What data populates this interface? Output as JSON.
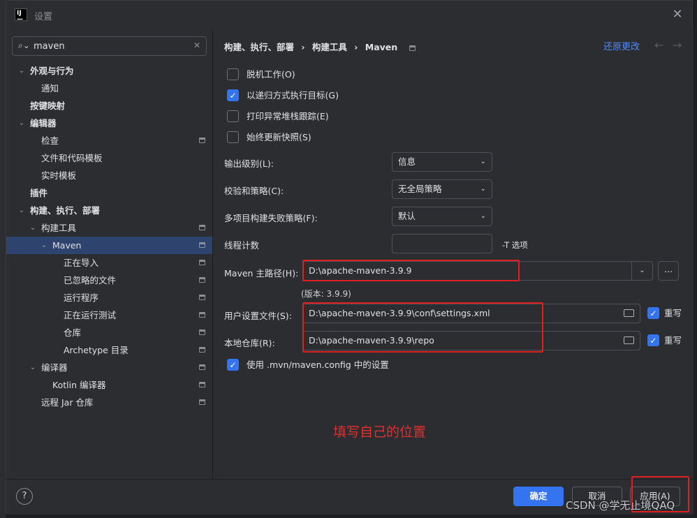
{
  "window": {
    "title": "设置"
  },
  "search": {
    "value": "maven"
  },
  "tree": {
    "appearance": "外观与行为",
    "notifications": "通知",
    "keymap": "按键映射",
    "editor": "编辑器",
    "inspections": "检查",
    "file_templates": "文件和代码模板",
    "live_templates": "实时模板",
    "plugins": "插件",
    "build": "构建、执行、部署",
    "build_tools": "构建工具",
    "maven": "Maven",
    "importing": "正在导入",
    "ignored_files": "已忽略的文件",
    "runner": "运行程序",
    "running_tests": "正在运行测试",
    "repositories": "仓库",
    "archetype": "Archetype 目录",
    "compiler": "编译器",
    "kotlin_compiler": "Kotlin 编译器",
    "remote_jar": "远程 Jar 仓库"
  },
  "breadcrumb": {
    "a": "构建、执行、部署",
    "sep": "›",
    "b": "构建工具",
    "c": "Maven"
  },
  "reset_label": "还原更改",
  "options": {
    "offline": "脱机工作(O)",
    "recursive": "以递归方式执行目标(G)",
    "print_stack": "打印异常堆栈跟踪(E)",
    "always_update": "始终更新快照(S)",
    "use_mvn_config": "使用 .mvn/maven.config 中的设置"
  },
  "form": {
    "output_level_label": "输出级别(L):",
    "output_level_value": "信息",
    "checksum_label": "校验和策略(C):",
    "checksum_value": "无全局策略",
    "fail_policy_label": "多项目构建失败策略(F):",
    "fail_policy_value": "默认",
    "threads_label": "线程计数",
    "threads_value": "",
    "threads_suffix": "-T 选项",
    "maven_home_label": "Maven 主路径(H):",
    "maven_home_value": "D:\\apache-maven-3.9.9",
    "version_text": "(版本: 3.9.9)",
    "user_settings_label": "用户设置文件(S):",
    "user_settings_value": "D:\\apache-maven-3.9.9\\conf\\settings.xml",
    "local_repo_label": "本地仓库(R):",
    "local_repo_value": "D:\\apache-maven-3.9.9\\repo",
    "override_label": "重写",
    "browse_label": "..."
  },
  "annotation_text": "填写自己的位置",
  "footer": {
    "help": "?",
    "ok": "确定",
    "cancel": "取消",
    "apply": "应用(A)"
  },
  "watermark": "CSDN @学无止境QAQ"
}
